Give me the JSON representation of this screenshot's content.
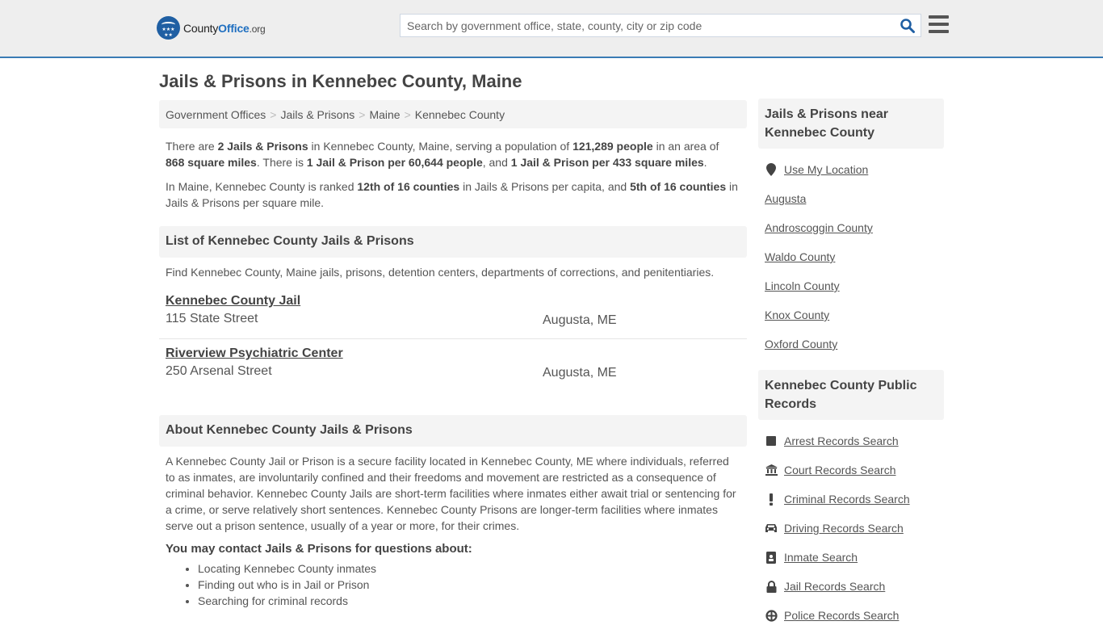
{
  "header": {
    "logo": {
      "county": "County",
      "office": "Office",
      "org": ".org"
    },
    "search_placeholder": "Search by government office, state, county, city or zip code",
    "search_icon": "search-icon",
    "menu_icon": "hamburger-menu-icon",
    "accent_color": "#1f6fc0",
    "border_color": "#3a7bb4"
  },
  "page_title": "Jails & Prisons in Kennebec County, Maine",
  "breadcrumb": [
    "Government Offices",
    "Jails & Prisons",
    "Maine",
    "Kennebec County"
  ],
  "intro": {
    "p1": {
      "t1": "There are ",
      "b1": "2 Jails & Prisons",
      "t2": " in Kennebec County, Maine, serving a population of ",
      "b2": "121,289 people",
      "t3": " in an area of ",
      "b3": "868 square miles",
      "t4": ". There is ",
      "b4": "1 Jail & Prison per 60,644 people",
      "t5": ", and ",
      "b5": "1 Jail & Prison per 433 square miles",
      "t6": "."
    },
    "p2": {
      "t1": "In Maine, Kennebec County is ranked ",
      "b1": "12th of 16 counties",
      "t2": " in Jails & Prisons per capita, and ",
      "b2": "5th of 16 counties",
      "t3": " in Jails & Prisons per square mile."
    }
  },
  "list_section": {
    "heading": "List of Kennebec County Jails & Prisons",
    "description": "Find Kennebec County, Maine jails, prisons, detention centers, departments of corrections, and penitentiaries.",
    "listings": [
      {
        "name": "Kennebec County Jail",
        "address": "115 State Street",
        "city": "Augusta, ME"
      },
      {
        "name": "Riverview Psychiatric Center",
        "address": "250 Arsenal Street",
        "city": "Augusta, ME"
      }
    ]
  },
  "about_section": {
    "heading": "About Kennebec County Jails & Prisons",
    "text": "A Kennebec County Jail or Prison is a secure facility located in Kennebec County, ME where individuals, referred to as inmates, are involuntarily confined and their freedoms and movement are restricted as a consequence of criminal behavior. Kennebec County Jails are short-term facilities where inmates either await trial or sentencing for a crime, or serve relatively short sentences. Kennebec County Prisons are longer-term facilities where inmates serve out a prison sentence, usually of a year or more, for their crimes.",
    "contact_heading": "You may contact Jails & Prisons for questions about:",
    "contact_items": [
      "Locating Kennebec County inmates",
      "Finding out who is in Jail or Prison",
      "Searching for criminal records"
    ]
  },
  "sidebar": {
    "nearby": {
      "heading": "Jails & Prisons near Kennebec County",
      "use_location": "Use My Location",
      "use_location_icon": "map-marker-icon",
      "items": [
        "Augusta",
        "Androscoggin County",
        "Waldo County",
        "Lincoln County",
        "Knox County",
        "Oxford County"
      ]
    },
    "public_records": {
      "heading": "Kennebec County Public Records",
      "items": [
        {
          "label": "Arrest Records Search",
          "icon": "square-icon"
        },
        {
          "label": "Court Records Search",
          "icon": "courthouse-icon"
        },
        {
          "label": "Criminal Records Search",
          "icon": "exclamation-icon"
        },
        {
          "label": "Driving Records Search",
          "icon": "car-icon"
        },
        {
          "label": "Inmate Search",
          "icon": "id-badge-icon"
        },
        {
          "label": "Jail Records Search",
          "icon": "lock-icon"
        },
        {
          "label": "Police Records Search",
          "icon": "police-badge-icon"
        }
      ]
    }
  }
}
